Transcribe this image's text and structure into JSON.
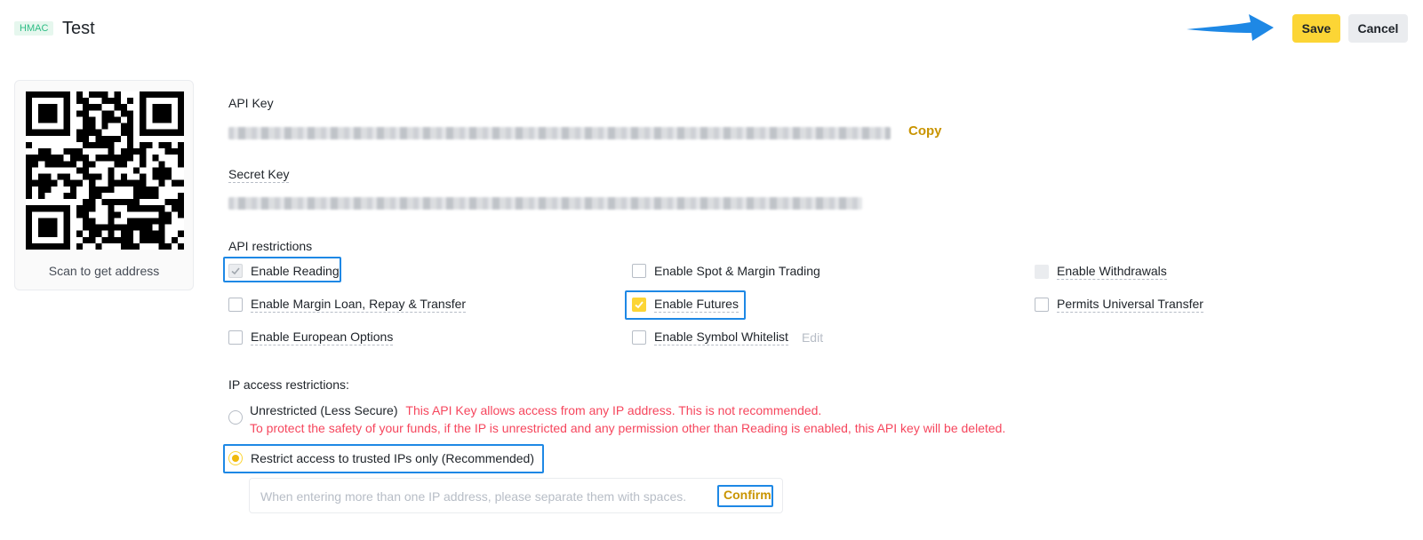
{
  "header": {
    "badge": "HMAC",
    "title": "Test",
    "save_label": "Save",
    "cancel_label": "Cancel"
  },
  "qr": {
    "caption": "Scan to get address"
  },
  "api_key": {
    "label": "API Key",
    "copy_label": "Copy"
  },
  "secret_key": {
    "label": "Secret Key"
  },
  "restrictions": {
    "label": "API restrictions",
    "items": [
      {
        "label": "Enable Reading",
        "checked": true
      },
      {
        "label": "Enable Spot & Margin Trading",
        "checked": false
      },
      {
        "label": "Enable Withdrawals",
        "checked": false,
        "disabled": true
      },
      {
        "label": "Enable Margin Loan, Repay & Transfer",
        "checked": false
      },
      {
        "label": "Enable Futures",
        "checked": true
      },
      {
        "label": "Permits Universal Transfer",
        "checked": false
      },
      {
        "label": "Enable European Options",
        "checked": false
      },
      {
        "label": "Enable Symbol Whitelist",
        "checked": false
      }
    ],
    "edit_label": "Edit"
  },
  "ip": {
    "label": "IP access restrictions:",
    "unrestricted_label": "Unrestricted (Less Secure)",
    "unrestricted_warning": "This API Key allows access from any IP address. This is not recommended.",
    "unrestricted_warning_2": "To protect the safety of your funds, if the IP is unrestricted and any permission other than Reading is enabled, this API key will be deleted.",
    "restricted_label": "Restrict access to trusted IPs only (Recommended)",
    "input_placeholder": "When entering more than one IP address, please separate them with spaces.",
    "input_value": "",
    "confirm_label": "Confirm"
  },
  "colors": {
    "accent": "#fcd535",
    "link": "#c99400",
    "warning": "#f6465d",
    "highlight": "#1e88e5"
  }
}
